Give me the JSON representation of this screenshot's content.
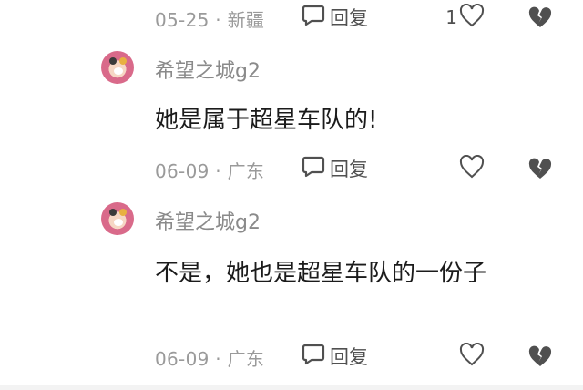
{
  "rows": [
    {
      "meta": "05-25 · 新疆",
      "reply_label": "回复",
      "like_count": "1"
    },
    {
      "meta": "06-09 · 广东",
      "reply_label": "回复",
      "like_count": ""
    },
    {
      "meta": "06-09 · 广东",
      "reply_label": "回复",
      "like_count": ""
    }
  ],
  "comments": [
    {
      "username": "希望之城g2",
      "text": "她是属于超星车队的!"
    },
    {
      "username": "希望之城g2",
      "text": "不是，她也是超星车队的一份子"
    }
  ],
  "icons": {
    "reply": "speech-bubble-icon",
    "like": "heart-outline-icon",
    "dislike": "broken-heart-icon"
  },
  "colors": {
    "meta_text": "#9a9a9a",
    "icon": "#505050",
    "body_text": "#1b1b1b",
    "avatar_bg": "#d96a8a"
  }
}
